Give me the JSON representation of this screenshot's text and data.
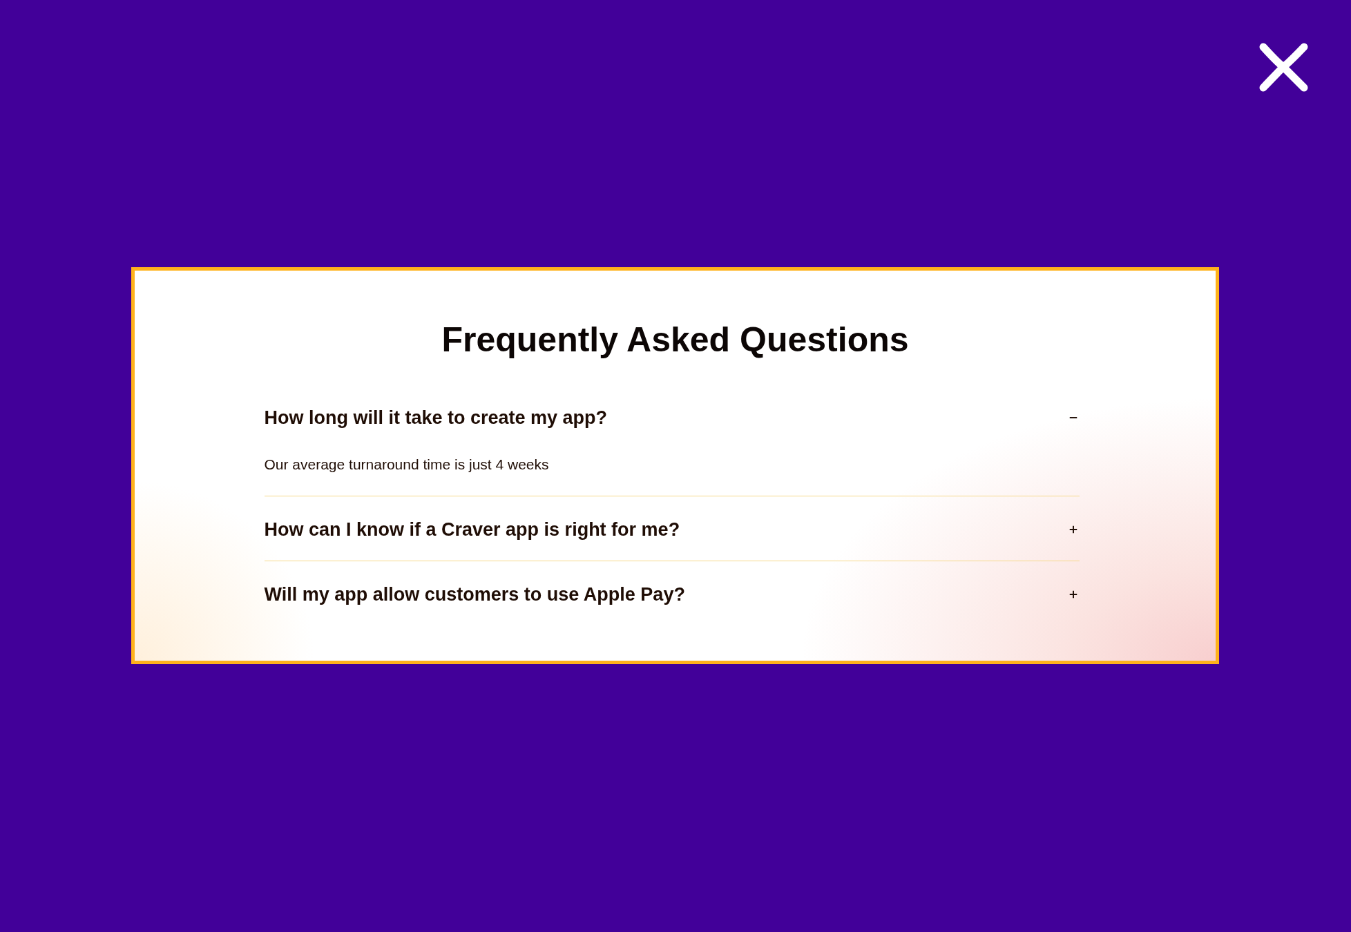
{
  "title": "Frequently Asked Questions",
  "faq": [
    {
      "question": "How long will it take to create my app?",
      "expanded": true,
      "answer": "Our average turnaround time is just 4 weeks"
    },
    {
      "question": "How can I know if a Craver app is right for me?",
      "expanded": false
    },
    {
      "question": "Will my app allow customers to use Apple Pay?",
      "expanded": false
    }
  ]
}
